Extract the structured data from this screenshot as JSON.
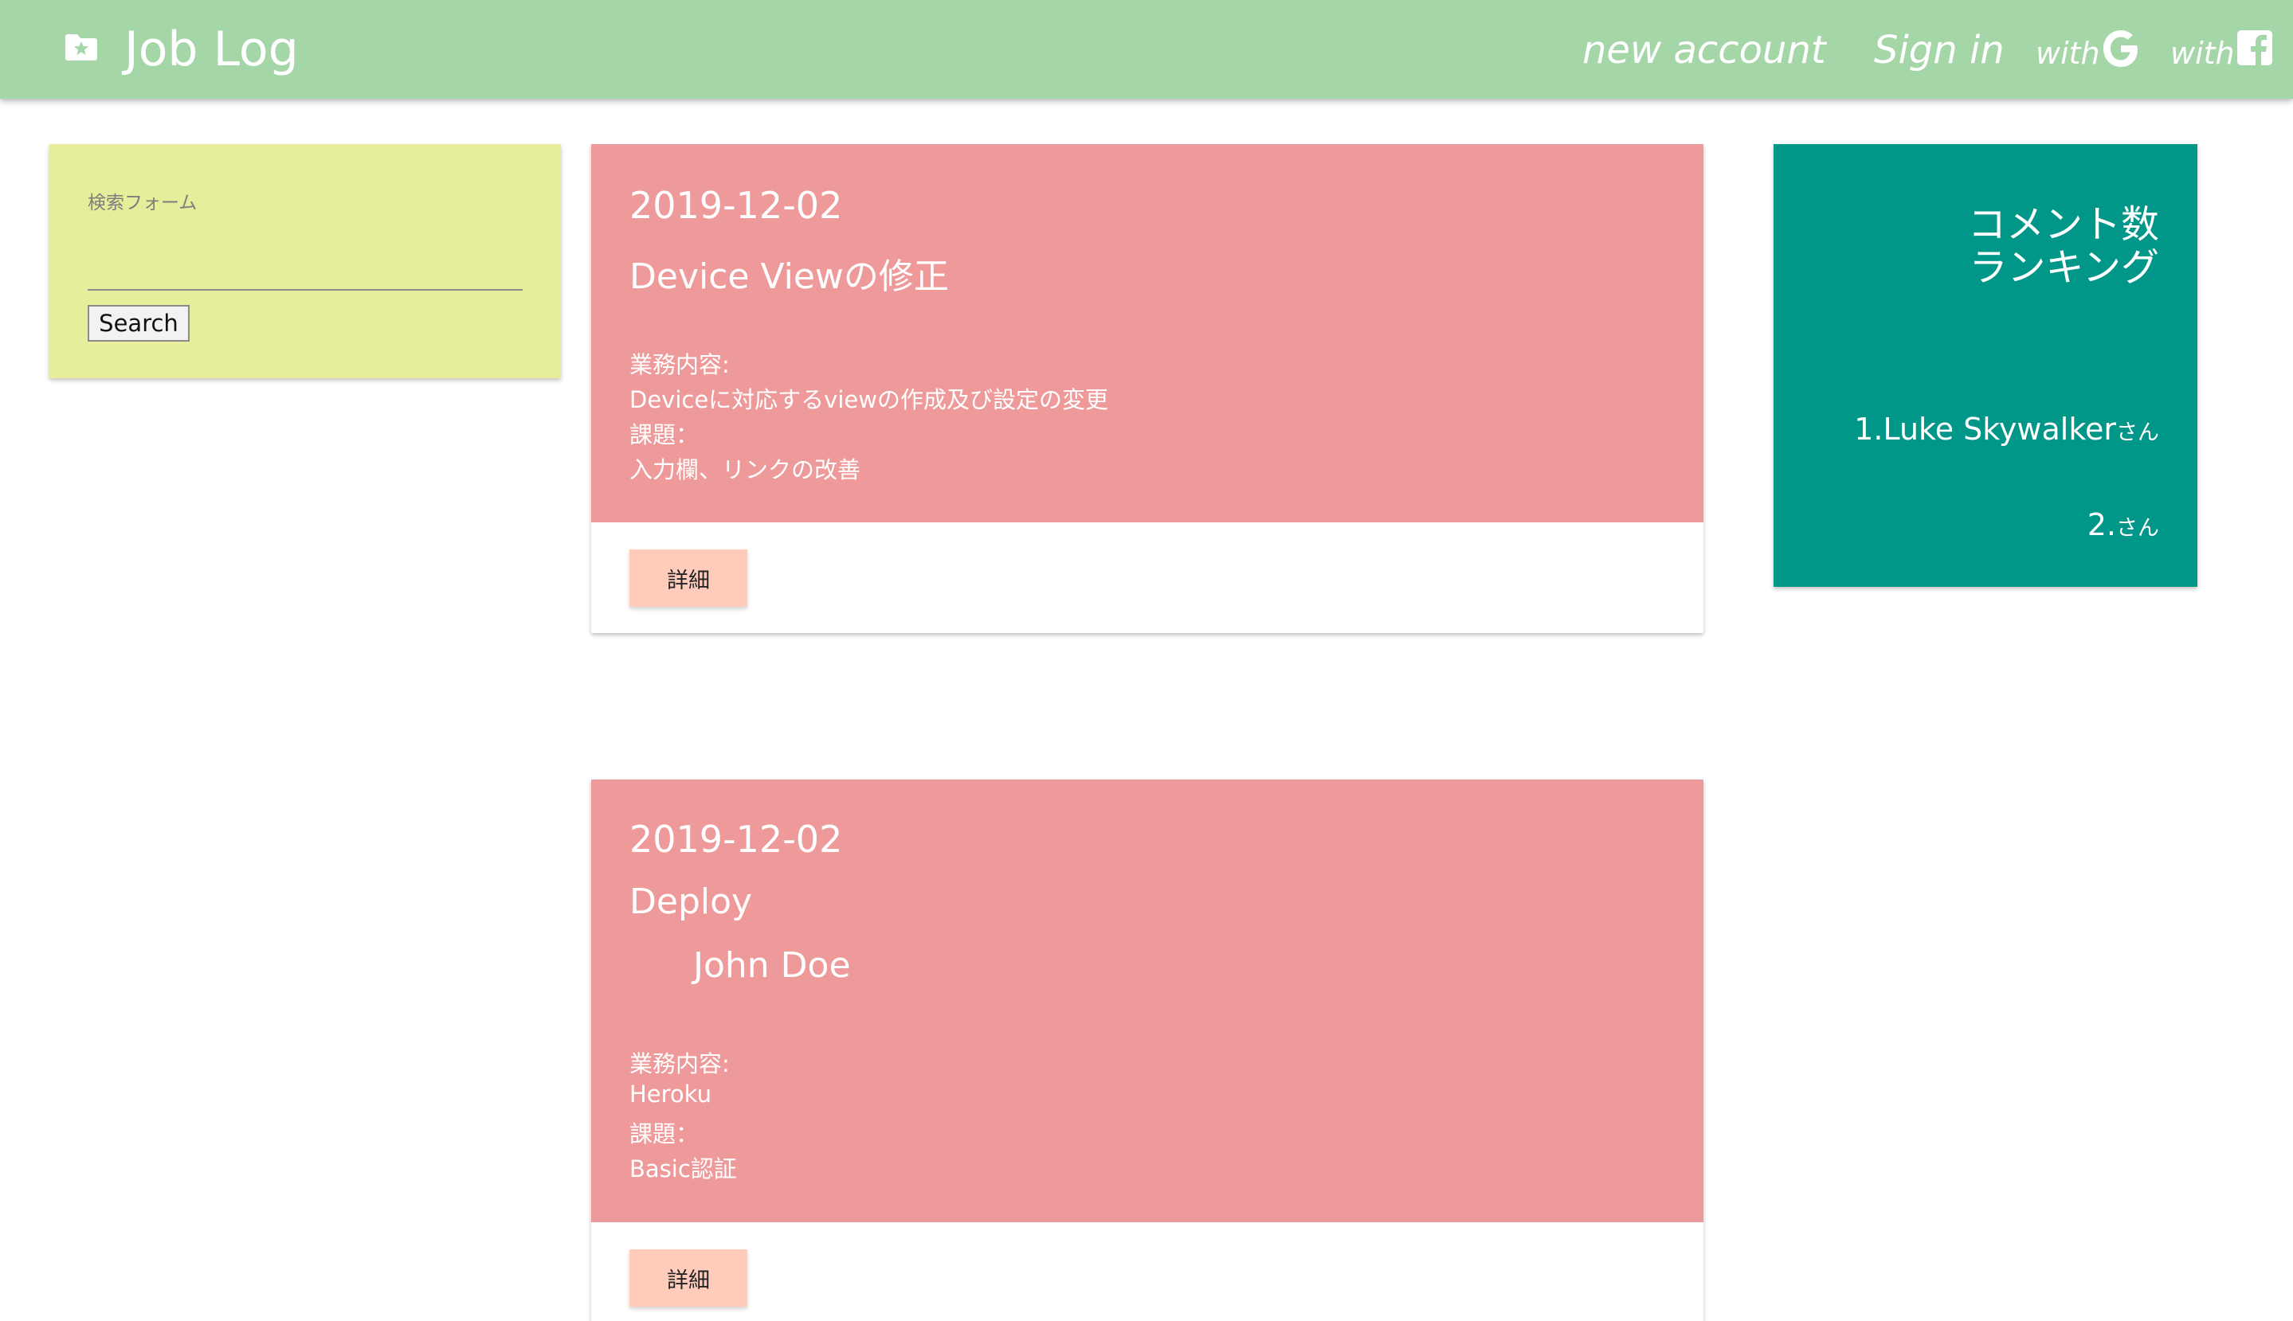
{
  "navbar": {
    "title": "Job Log",
    "brand_icon": "folder-star-icon",
    "new_account": "new account",
    "sign_in": "Sign in",
    "with_google": "with",
    "with_facebook": "with",
    "background": "#a5d6a7"
  },
  "search": {
    "label": "検索フォーム",
    "input_value": "",
    "button_label": "Search",
    "background": "#e6ee9c"
  },
  "posts": [
    {
      "date": "2019-12-02",
      "title": "Device Viewの修正",
      "author": "",
      "task_label": "業務内容:",
      "task": "Deviceに対応するviewの作成及び設定の変更",
      "issue_label": "課題：",
      "issue": "入力欄、リンクの改善",
      "detail_button": "詳細"
    },
    {
      "date": "2019-12-02",
      "title": "Deploy",
      "author": "John Doe",
      "task_label": "業務内容:",
      "task": "Heroku",
      "issue_label": "課題：",
      "issue": "Basic認証",
      "detail_button": "詳細"
    }
  ],
  "post_colors": {
    "content": "#ef9a9a",
    "button": "#ffccbc"
  },
  "ranking": {
    "title": "コメント数\nランキング",
    "items": [
      {
        "rank": "1.",
        "name": "Luke Skywalker",
        "suffix": "さん"
      },
      {
        "rank": "2.",
        "name": "",
        "suffix": "さん"
      }
    ],
    "background": "#009688"
  }
}
